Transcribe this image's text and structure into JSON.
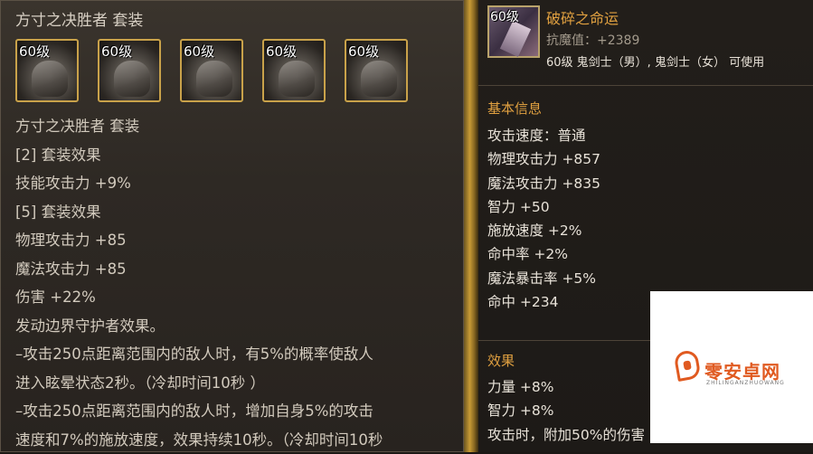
{
  "set_panel": {
    "title": "方寸之决胜者 套装",
    "items": [
      {
        "level": "60级",
        "icon": "helmet-armor-icon"
      },
      {
        "level": "60级",
        "icon": "chest-armor-icon"
      },
      {
        "level": "60级",
        "icon": "shoulder-armor-icon"
      },
      {
        "level": "60级",
        "icon": "belt-armor-icon"
      },
      {
        "level": "60级",
        "icon": "boots-armor-icon"
      }
    ],
    "lines": [
      "方寸之决胜者 套装",
      "[2] 套装效果",
      "技能攻击力 +9%",
      "[5] 套装效果",
      "物理攻击力 +85",
      "魔法攻击力 +85",
      "伤害 +22%",
      "发动边界守护者效果。",
      "–攻击250点距离范围内的敌人时，有5%的概率使敌人",
      "进入眩晕状态2秒。（冷却时间10秒 ）",
      "–攻击250点距离范围内的敌人时，增加自身5%的攻击",
      "速度和7%的施放速度，效果持续10秒。（冷却时间10秒"
    ]
  },
  "item_panel": {
    "level": "60级",
    "icon": "broken-blade-icon",
    "name": "破碎之命运",
    "resist": "抗魔值：+2389",
    "usable": "60级 鬼剑士（男）, 鬼剑士（女） 可使用",
    "basic_title": "基本信息",
    "stats": [
      "攻击速度：普通",
      "物理攻击力 +857",
      "魔法攻击力 +835",
      "智力 +50",
      "施放速度 +2%",
      "命中率 +2%",
      "魔法暴击率 +5%",
      "命中 +234"
    ],
    "effect_title": "效果",
    "effects": [
      "力量 +8%",
      "智力 +8%",
      "攻击时，附加50%的伤害"
    ]
  },
  "watermark": {
    "text": "零安卓网",
    "sub": "ZHILINGANZHUOWANG",
    "icon": "watermark-logo-icon"
  },
  "colors": {
    "gold_title": "#e0a040",
    "item_border": "#c9a24a",
    "watermark": "#e05a20"
  }
}
